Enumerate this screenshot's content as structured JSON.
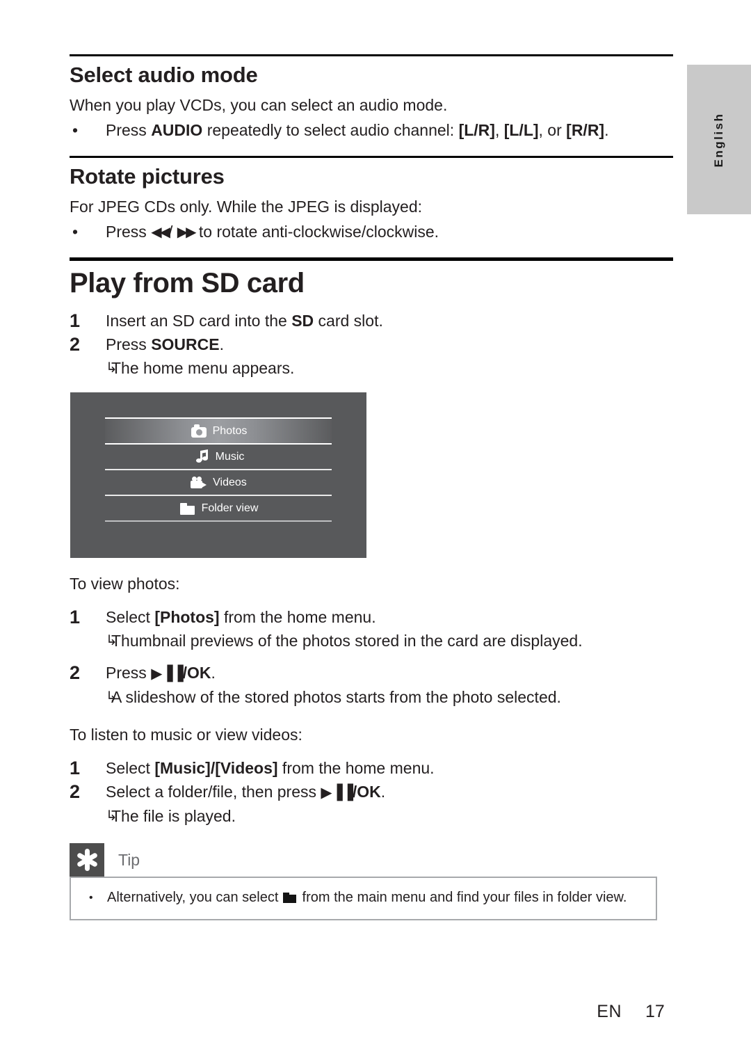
{
  "language_tab": {
    "label": "English"
  },
  "sections": [
    {
      "id": "select-audio-mode",
      "title": "Select audio mode",
      "intro": "When you play VCDs, you can select an audio mode.",
      "bullet": {
        "prefix": "Press ",
        "key": "AUDIO",
        "middle": " repeatedly to select audio channel: ",
        "opt1": "[L/R]",
        "sep1": ", ",
        "opt2": "[L/L]",
        "sep2": ", or ",
        "opt3": "[R/R]",
        "suffix": "."
      }
    },
    {
      "id": "rotate-pictures",
      "title": "Rotate pictures",
      "intro": "For JPEG CDs only. While the JPEG is displayed:",
      "bullet": {
        "prefix": "Press ",
        "rev_glyph": "◀◀",
        "slash": "/ ",
        "fwd_glyph": "▶▶",
        "suffix": " to rotate anti-clockwise/clockwise."
      }
    }
  ],
  "chapter": {
    "title": "Play from SD card",
    "steps": [
      {
        "number": "1",
        "text_before": "Insert an SD card into the ",
        "bold": "SD",
        "text_after": " card slot."
      },
      {
        "number": "2",
        "text_before": "Press ",
        "bold": "SOURCE",
        "text_after": ".",
        "sub": "The home menu appears."
      }
    ]
  },
  "home_menu_screenshot": {
    "items": [
      {
        "label": "Photos",
        "icon": "camera-icon",
        "selected": true
      },
      {
        "label": "Music",
        "icon": "music-note-icon",
        "selected": false
      },
      {
        "label": "Videos",
        "icon": "video-camera-icon",
        "selected": false
      },
      {
        "label": "Folder view",
        "icon": "folder-icon",
        "selected": false
      }
    ],
    "background_color": "#58595b",
    "highlight_color": "#9c9ea2"
  },
  "view_photos": {
    "lead": "To view photos:",
    "steps": [
      {
        "number": "1",
        "text_before": "Select ",
        "bold": "[Photos]",
        "text_after": " from the home menu.",
        "sub": "Thumbnail previews of the photos stored in the card are displayed."
      },
      {
        "number": "2",
        "text_before": "Press ",
        "glyph": "▶▐▐",
        "bold": "/OK",
        "text_after": ".",
        "sub": "A slideshow of the stored photos starts from the photo selected."
      }
    ]
  },
  "music_videos": {
    "lead": "To listen to music or view videos:",
    "steps": [
      {
        "number": "1",
        "text_before": "Select ",
        "bold": "[Music]/[Videos]",
        "text_after": " from the home menu."
      },
      {
        "number": "2",
        "text_before": "Select a folder/file, then press ",
        "glyph": "▶▐▐",
        "bold": "/OK",
        "text_after": ".",
        "sub": "The file is played."
      }
    ]
  },
  "tip": {
    "label": "Tip",
    "bullet_char": "•",
    "text_before": "Alternatively, you can select ",
    "icon": "folder-icon",
    "text_after": " from the main menu and find your files in folder view."
  },
  "footer": {
    "locale": "EN",
    "page_number": "17"
  }
}
